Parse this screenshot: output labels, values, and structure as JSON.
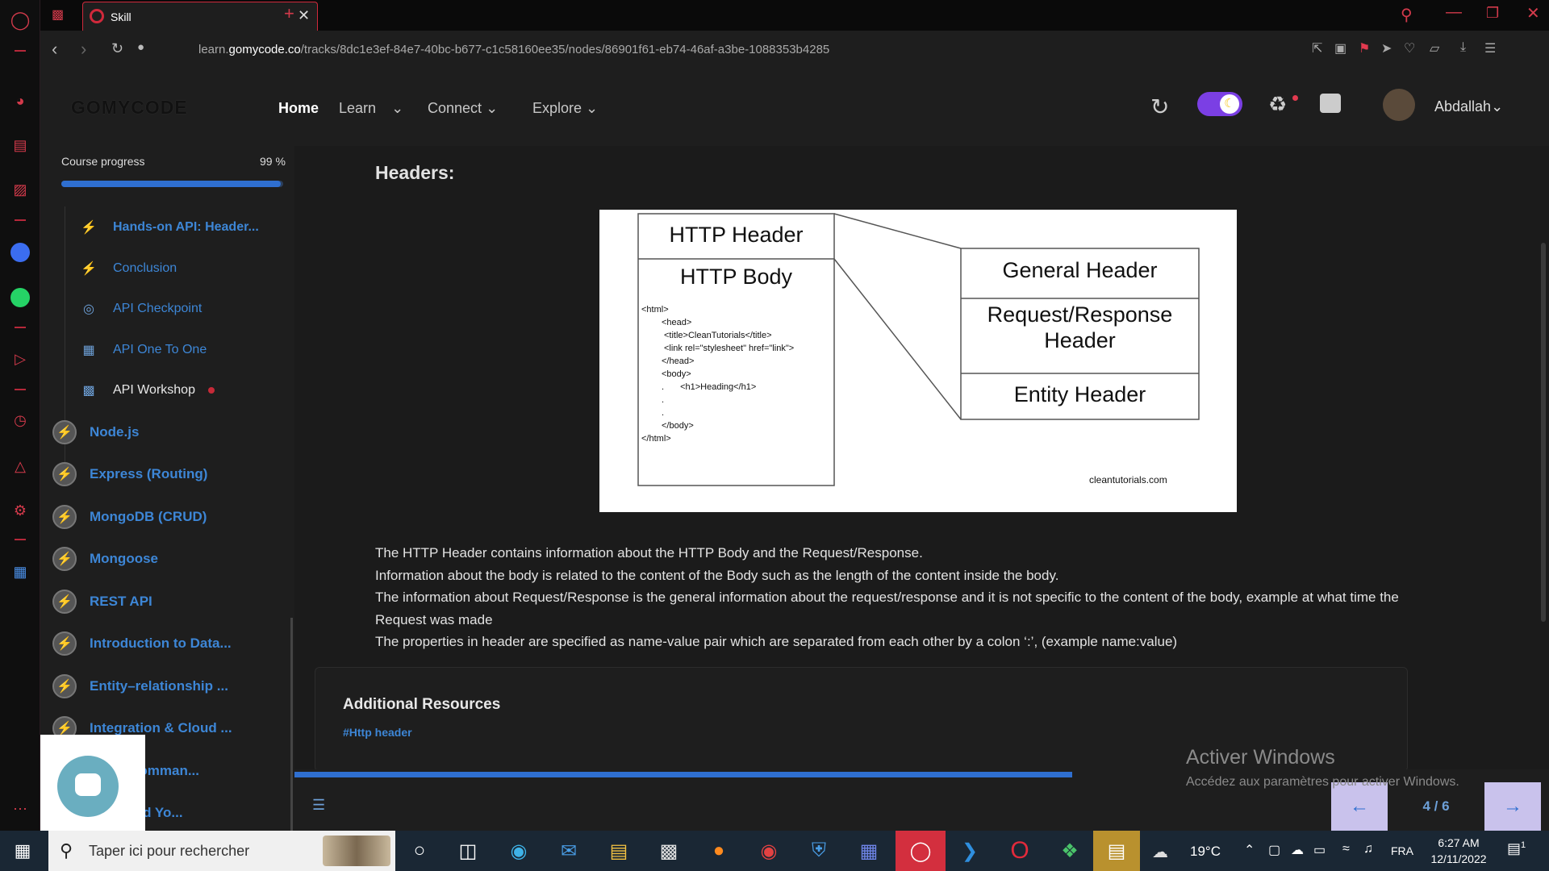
{
  "browser": {
    "tab_title": "Skill",
    "url_prefix": "learn.",
    "url_host": "gomycode.co",
    "url_path": "/tracks/8dc1e3ef-84e7-40bc-b677-c1c58160ee35/nodes/86901f61-eb74-46af-a3be-1088353b4285"
  },
  "header": {
    "logo": "GOMYCODE",
    "nav": [
      "Home",
      "Learn",
      "Connect",
      "Explore"
    ],
    "user_name": "Abdallah"
  },
  "sidebar": {
    "progress_label": "Course progress",
    "progress_value": "99 %",
    "progress_fraction": 0.99,
    "lessons": [
      {
        "label": "Hands-on API: Header...",
        "icon": "bolt-icon"
      },
      {
        "label": "Conclusion",
        "icon": "bolt-icon"
      },
      {
        "label": "API Checkpoint",
        "icon": "target-icon"
      },
      {
        "label": "API One To One",
        "icon": "people-icon"
      },
      {
        "label": "API Workshop",
        "icon": "workshop-icon"
      }
    ],
    "modules": [
      "Node.js",
      "Express (Routing)",
      "MongoDB (CRUD)",
      "Mongoose",
      "REST API",
      "Introduction to Data...",
      "Entity–relationship ...",
      "Integration & Cloud ...",
      "Flow (Comman...",
      "se : Build Yo..."
    ]
  },
  "content": {
    "heading": "Headers:",
    "diagram": {
      "header_box": "HTTP Header",
      "body_box": "HTTP Body",
      "code_lines": [
        "<html>",
        "<head>",
        "<title>CleanTutorials</title>",
        "<link rel=\"stylesheet\" href=\"link\">",
        "</head>",
        "<body>",
        "<h1>Heading</h1>",
        ".",
        ".",
        "</body>",
        "</html>"
      ],
      "general": "General Header",
      "request_response_1": "Request/Response",
      "request_response_2": "Header",
      "entity": "Entity Header",
      "credit": "cleantutorials.com"
    },
    "paragraphs": [
      "The HTTP Header contains information about the HTTP Body and the Request/Response.",
      "Information about the body is related to the content of the Body such as the length of the content inside the body.",
      "The information about Request/Response is the general information about the request/response and it is not specific to the content of the body, example at what time the",
      "Request was made",
      "The properties in header are specified as name-value pair which are separated from each other by a colon ‘:’, (example name:value)"
    ],
    "resources_title": "Additional Resources",
    "resource_tag": "#Http header",
    "page_indicator": "4 / 6",
    "page_progress_fraction": 0.62
  },
  "watermark": {
    "title": "Activer Windows",
    "subtitle": "Accédez aux paramètres pour activer Windows."
  },
  "taskbar": {
    "search_placeholder": "Taper ici pour rechercher",
    "weather": "19°C",
    "language": "FRA",
    "time": "6:27 AM",
    "date": "12/11/2022",
    "notification_count": "1"
  },
  "colors": {
    "accent": "#3d86d6",
    "opera_red": "#d0293b",
    "toggle": "#7b3fe4"
  }
}
